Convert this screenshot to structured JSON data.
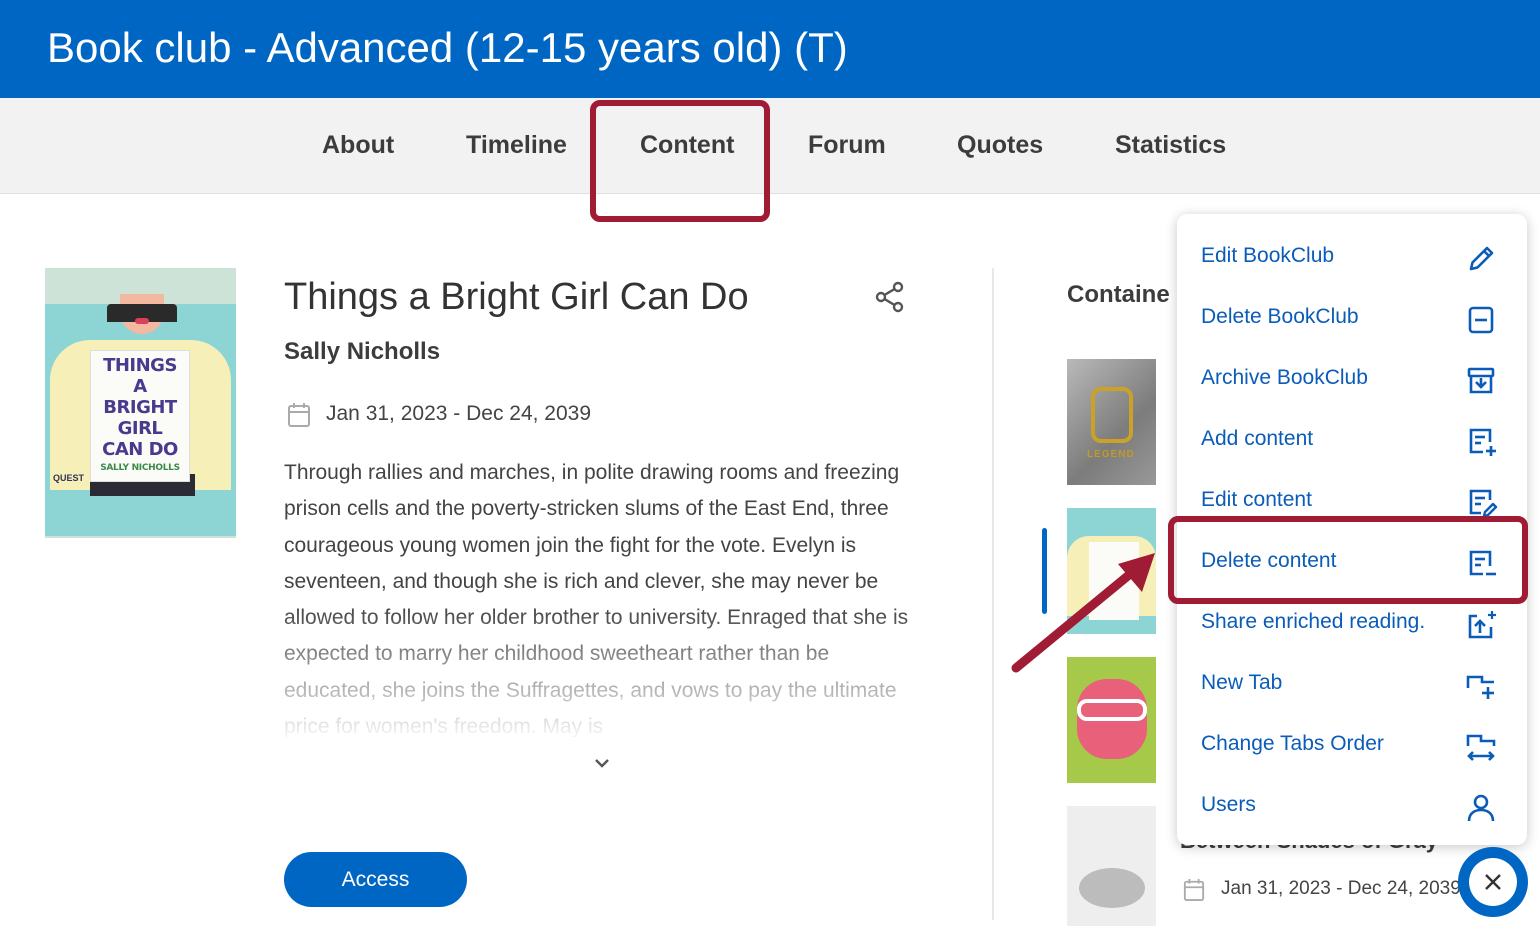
{
  "header": {
    "title": "Book club - Advanced (12-15 years old) (T)"
  },
  "tabs": [
    {
      "label": "About"
    },
    {
      "label": "Timeline"
    },
    {
      "label": "Content",
      "active": true
    },
    {
      "label": "Forum"
    },
    {
      "label": "Quotes"
    },
    {
      "label": "Statistics"
    }
  ],
  "book": {
    "title": "Things a Bright Girl Can Do",
    "author": "Sally Nicholls",
    "dates": "Jan 31, 2023 - Dec 24, 2039",
    "description": "Through rallies and marches, in polite drawing rooms and freezing prison cells and the poverty-stricken slums of the East End, three courageous young women join the fight for the vote. Evelyn is seventeen, and though she is rich and clever, she may never be allowed to follow her older brother to university. Enraged that she is expected to marry her childhood sweetheart rather than be educated, she joins the Suffragettes, and vows to pay the ultimate price for women's freedom. May is",
    "access_label": "Access",
    "cover": {
      "lines": [
        "THINGS",
        "A",
        "BRIGHT",
        "GIRL",
        "CAN DO"
      ],
      "author": "SALLY NICHOLLS",
      "publisher": "QUEST"
    }
  },
  "sidebar": {
    "contained_label": "Containe",
    "thumbs": [
      {
        "word": "LEGEND"
      },
      {
        "word": ""
      },
      {
        "word": ""
      },
      {
        "word": ""
      }
    ],
    "next_item": {
      "title": "Between Shades of Gray",
      "dates": "Jan 31, 2023 - Dec 24, 2039"
    }
  },
  "menu": {
    "items": [
      {
        "label": "Edit BookClub",
        "icon": "pencil-icon"
      },
      {
        "label": "Delete BookClub",
        "icon": "minus-square-icon"
      },
      {
        "label": "Archive BookClub",
        "icon": "archive-icon"
      },
      {
        "label": "Add content",
        "icon": "add-content-icon"
      },
      {
        "label": "Edit content",
        "icon": "edit-content-icon"
      },
      {
        "label": "Delete content",
        "icon": "delete-content-icon",
        "highlighted": true
      },
      {
        "label": "Share enriched reading.",
        "icon": "share-enriched-icon"
      },
      {
        "label": "New Tab",
        "icon": "new-tab-icon"
      },
      {
        "label": "Change Tabs Order",
        "icon": "swap-tabs-icon"
      },
      {
        "label": "Users",
        "icon": "user-icon"
      }
    ]
  },
  "colors": {
    "primary": "#0066c4",
    "annotation": "#a01c35",
    "menu_text": "#0a5cb8"
  }
}
